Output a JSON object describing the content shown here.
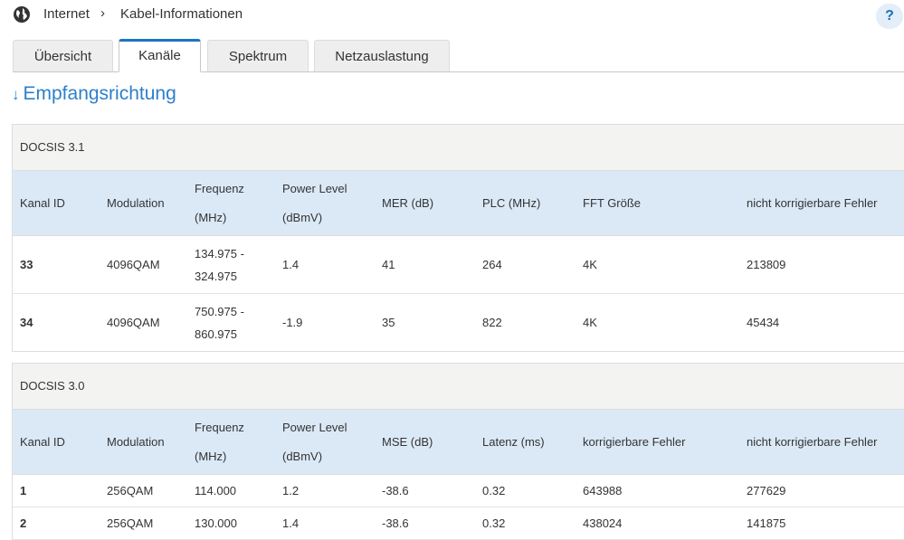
{
  "breadcrumb": {
    "root": "Internet",
    "separator": "›",
    "current": "Kabel-Informationen"
  },
  "help_label": "?",
  "tabs": [
    {
      "label": "Übersicht",
      "active": false
    },
    {
      "label": "Kanäle",
      "active": true
    },
    {
      "label": "Spektrum",
      "active": false
    },
    {
      "label": "Netzauslastung",
      "active": false
    }
  ],
  "section": {
    "arrow": "↓",
    "title": "Empfangsrichtung"
  },
  "docsis31": {
    "caption": "DOCSIS 3.1",
    "headers": [
      "Kanal ID",
      "Modulation",
      "Frequenz\n(MHz)",
      "Power Level\n(dBmV)",
      "MER (dB)",
      "PLC (MHz)",
      "FFT Größe",
      "nicht korrigierbare Fehler"
    ],
    "rows": [
      [
        "33",
        "4096QAM",
        "134.975 -\n324.975",
        "1.4",
        "41",
        "264",
        "4K",
        "213809"
      ],
      [
        "34",
        "4096QAM",
        "750.975 -\n860.975",
        "-1.9",
        "35",
        "822",
        "4K",
        "45434"
      ]
    ]
  },
  "docsis30": {
    "caption": "DOCSIS 3.0",
    "headers": [
      "Kanal ID",
      "Modulation",
      "Frequenz\n(MHz)",
      "Power Level\n(dBmV)",
      "MSE (dB)",
      "Latenz (ms)",
      "korrigierbare Fehler",
      "nicht korrigierbare Fehler"
    ],
    "rows": [
      [
        "1",
        "256QAM",
        "114.000",
        "1.2",
        "-38.6",
        "0.32",
        "643988",
        "277629"
      ],
      [
        "2",
        "256QAM",
        "130.000",
        "1.4",
        "-38.6",
        "0.32",
        "438024",
        "141875"
      ]
    ]
  },
  "colors": {
    "accent": "#2d7fcb",
    "header_bg": "#dbe9f7",
    "caption_bg": "#f3f3f2"
  }
}
